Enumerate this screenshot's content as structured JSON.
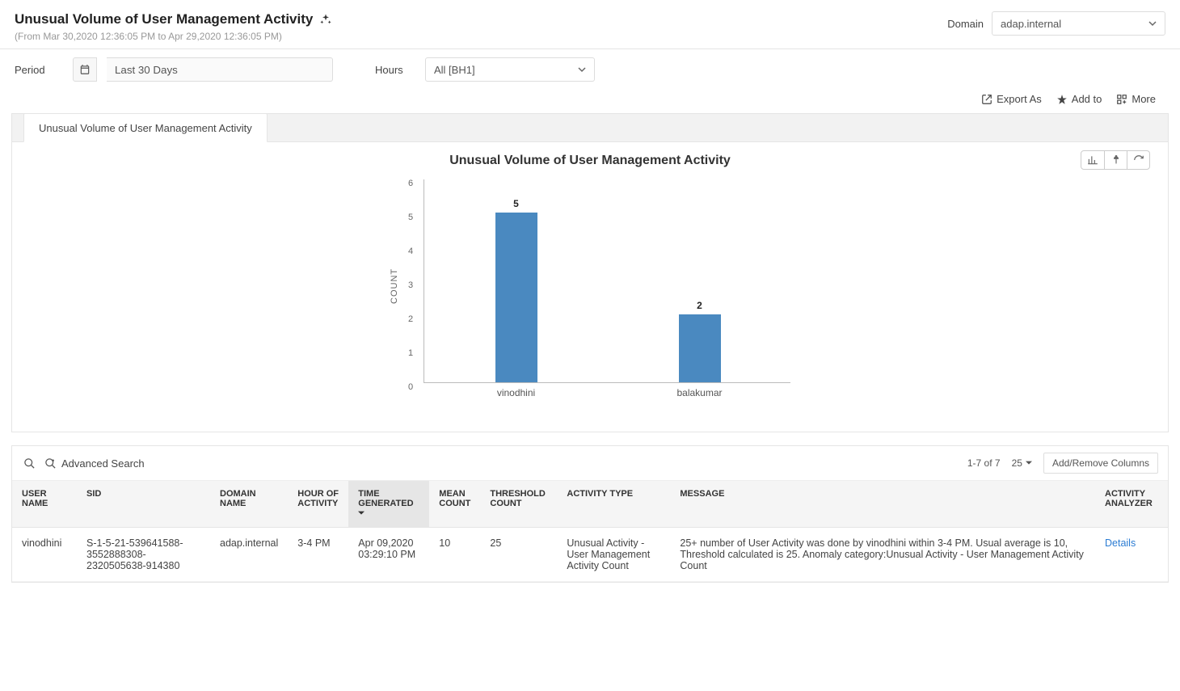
{
  "header": {
    "title": "Unusual Volume of User Management Activity",
    "subtitle": "(From Mar 30,2020 12:36:05 PM to Apr 29,2020 12:36:05 PM)",
    "domain_label": "Domain",
    "domain_value": "adap.internal"
  },
  "filters": {
    "period_label": "Period",
    "period_value": "Last 30 Days",
    "hours_label": "Hours",
    "hours_value": "All [BH1]"
  },
  "actions": {
    "export": "Export As",
    "addto": "Add to",
    "more": "More"
  },
  "tab_label": "Unusual Volume of User Management Activity",
  "chart_title": "Unusual Volume of User Management Activity",
  "chart_data": {
    "type": "bar",
    "title": "Unusual Volume of User Management Activity",
    "ylabel": "COUNT",
    "xlabel": "",
    "ylim": [
      0,
      6
    ],
    "yticks": [
      0,
      1,
      2,
      3,
      4,
      5,
      6
    ],
    "categories": [
      "vinodhini",
      "balakumar"
    ],
    "values": [
      5,
      2
    ]
  },
  "search": {
    "advanced_label": "Advanced Search"
  },
  "pagination": {
    "status": "1-7 of 7",
    "page_size": "25"
  },
  "columns_button": "Add/Remove Columns",
  "table": {
    "headers": {
      "user": "USER NAME",
      "sid": "SID",
      "domain": "DOMAIN NAME",
      "hour": "HOUR OF ACTIVITY",
      "time": "TIME GENERATED",
      "mean": "MEAN COUNT",
      "threshold": "THRESHOLD COUNT",
      "activity_type": "ACTIVITY TYPE",
      "message": "MESSAGE",
      "analyzer": "ACTIVITY ANALYZER"
    },
    "rows": [
      {
        "user": "vinodhini",
        "sid": "S-1-5-21-539641588-3552888308-2320505638-914380",
        "domain": "adap.internal",
        "hour": "3-4 PM",
        "time": "Apr 09,2020 03:29:10 PM",
        "mean": "10",
        "threshold": "25",
        "activity_type": "Unusual Activity - User Management Activity Count",
        "message": "25+ number of User Activity was done by vinodhini within 3-4 PM. Usual average is 10, Threshold calculated is 25. Anomaly category:Unusual Activity - User Management Activity Count",
        "analyzer": "Details"
      }
    ]
  }
}
